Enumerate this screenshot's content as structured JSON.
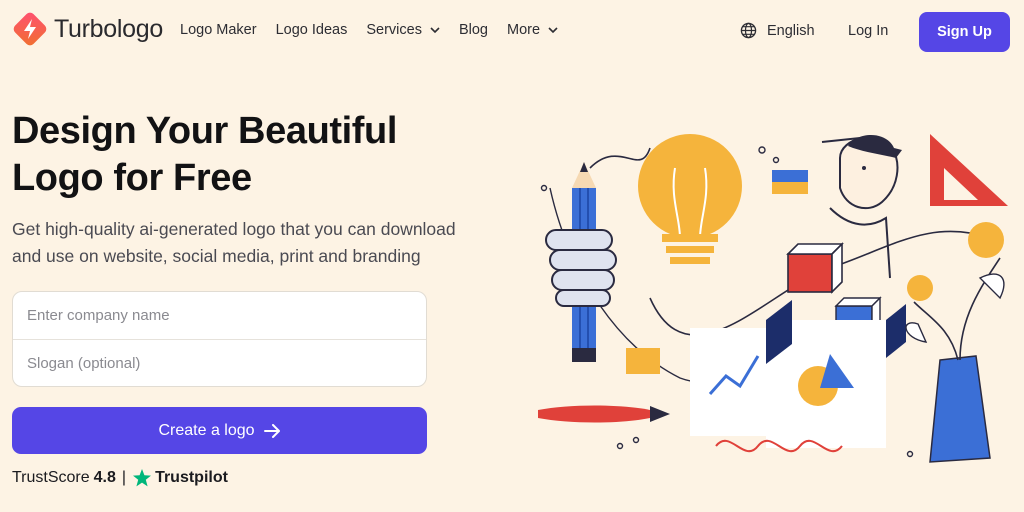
{
  "brand": {
    "name": "Turbologo"
  },
  "nav": {
    "links": [
      {
        "label": "Logo Maker",
        "has_dropdown": false
      },
      {
        "label": "Logo Ideas",
        "has_dropdown": false
      },
      {
        "label": "Services",
        "has_dropdown": true
      },
      {
        "label": "Blog",
        "has_dropdown": false
      },
      {
        "label": "More",
        "has_dropdown": true
      }
    ],
    "language": "English",
    "login": "Log In",
    "signup": "Sign Up"
  },
  "hero": {
    "title_line1": "Design Your Beautiful",
    "title_line2": "Logo for Free",
    "subtitle_line1": "Get high-quality ai-generated logo that you can download",
    "subtitle_line2": "and use on website, social media, print and branding",
    "company_placeholder": "Enter company name",
    "company_value": "",
    "slogan_placeholder": "Slogan (optional)",
    "slogan_value": "",
    "cta_label": "Create a logo",
    "trust_label": "TrustScore",
    "trust_score": "4.8",
    "trust_separator": "|",
    "trust_brand": "Trustpilot"
  },
  "colors": {
    "background": "#fdf3e4",
    "accent": "#5546e6",
    "trustpilot_green": "#00b67a",
    "logo_gradient_start": "#ff5a5a",
    "logo_gradient_end": "#f06a3a"
  },
  "icons": {
    "logo": "turbologo-mark-icon",
    "language": "globe-icon",
    "dropdown": "chevron-down-icon",
    "cta": "arrow-right-icon",
    "trust": "star-icon"
  }
}
